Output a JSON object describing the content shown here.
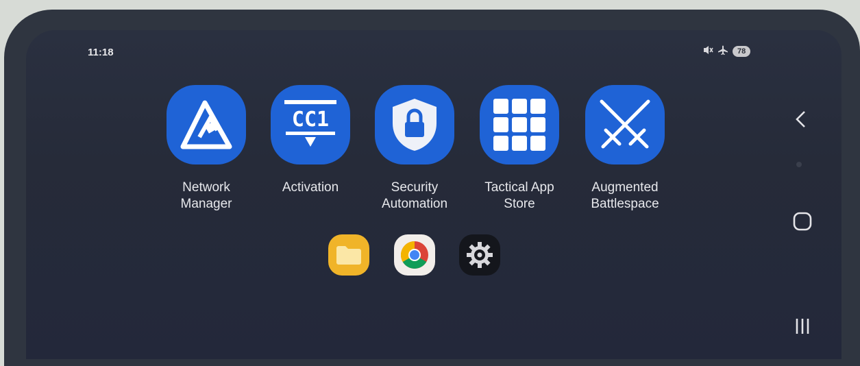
{
  "status_bar": {
    "time": "11:18",
    "icons": [
      "mute-vibrate-icon",
      "airplane-icon"
    ],
    "battery": "78"
  },
  "apps": [
    {
      "label_line1": "Network",
      "label_line2": "Manager",
      "icon": "network-triangle-icon"
    },
    {
      "label_line1": "Activation",
      "label_line2": "",
      "icon": "cc1-activation-icon",
      "icon_text": "CC1"
    },
    {
      "label_line1": "Security",
      "label_line2": "Automation",
      "icon": "shield-lock-icon"
    },
    {
      "label_line1": "Tactical App",
      "label_line2": "Store",
      "icon": "grid-icon"
    },
    {
      "label_line1": "Augmented",
      "label_line2": "Battlespace",
      "icon": "crossed-swords-icon"
    }
  ],
  "dock": [
    {
      "icon": "folder-icon"
    },
    {
      "icon": "chrome-icon"
    },
    {
      "icon": "settings-gear-icon"
    }
  ],
  "nav": [
    "back-icon",
    "home-icon",
    "recents-icon"
  ],
  "colors": {
    "app_icon_bg": "#1f63d6",
    "screen_bg": "#262b39",
    "case": "#2f3540"
  }
}
